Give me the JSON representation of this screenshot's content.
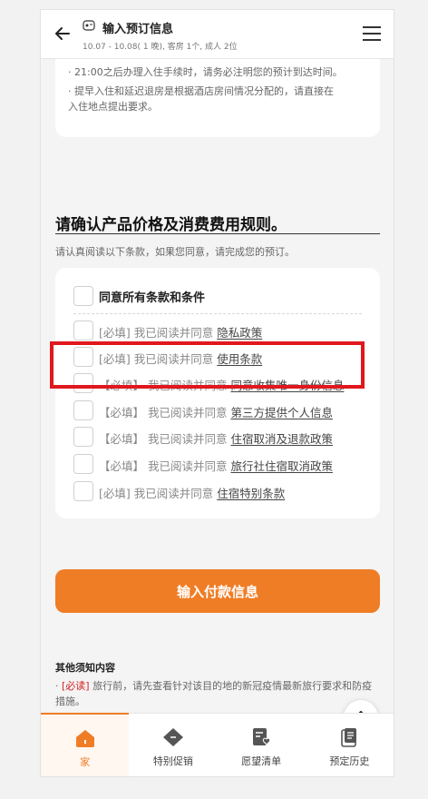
{
  "header": {
    "title": "输入预订信息",
    "subtitle": "10.07 - 10.08( 1 晚), 客房 1个, 成人 2位"
  },
  "notes": [
    "· 21:00之后办理入住手续时，请务必注明您的预计到达时间。",
    "· 提早入住和延迟退房是根据酒店房间情况分配的，请直接在",
    "  入住地点提出要求。"
  ],
  "section": {
    "title": "请确认产品价格及消费费用规则。",
    "subtitle": "请认真阅读以下条款，如果您同意，请完成您的预订。"
  },
  "terms": {
    "all_label": "同意所有条款和条件",
    "items": [
      {
        "prefix": "[必填] 我已阅读并同意 ",
        "link": "隐私政策"
      },
      {
        "prefix": "[必填] 我已阅读并同意 ",
        "link": "使用条款"
      },
      {
        "prefix": "【必填】 我已阅读并同意 ",
        "link": "同意收集唯一身份信息"
      },
      {
        "prefix": "【必填】 我已阅读并同意 ",
        "link": "第三方提供个人信息"
      },
      {
        "prefix": "【必填】 我已阅读并同意 ",
        "link": "住宿取消及退款政策"
      },
      {
        "prefix": "【必填】 我已阅读并同意 ",
        "link": "旅行社住宿取消政策"
      },
      {
        "prefix": "[必填] 我已阅读并同意 ",
        "link": "住宿特别条款"
      }
    ]
  },
  "pay_button": "输入付款信息",
  "other": {
    "title": "其他须知内容",
    "req": "[必读]",
    "text": " 旅行前，请先查看针对该目的地的新冠疫情最新旅行要求和防疫措施。"
  },
  "tabs": [
    {
      "label": "家",
      "icon": "home-icon"
    },
    {
      "label": "特别促销",
      "icon": "ticket-icon"
    },
    {
      "label": "愿望清单",
      "icon": "wishlist-icon"
    },
    {
      "label": "预定历史",
      "icon": "history-icon"
    }
  ],
  "colors": {
    "accent": "#ef7d26",
    "highlight": "#e0181e"
  }
}
